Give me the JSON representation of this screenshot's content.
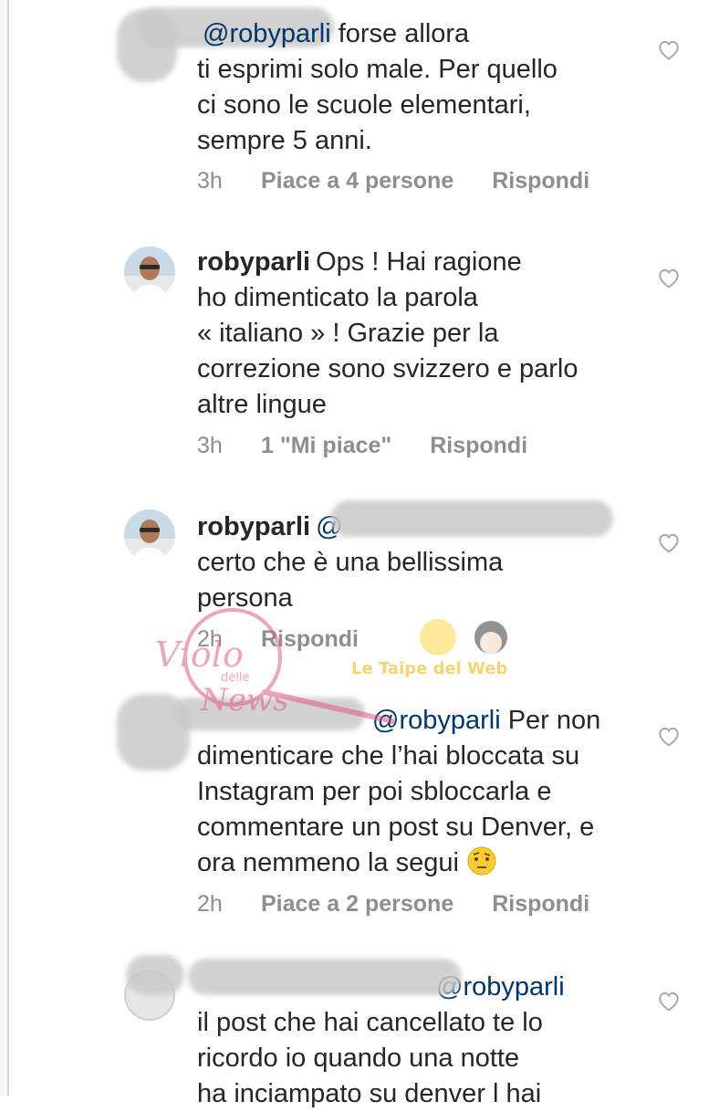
{
  "comments": [
    {
      "username": "",
      "mention": "@robyparli",
      "text": " forse allora\nti esprimi solo male. Per quello\nci sono le scuole elementari,\nsempre 5 anni.",
      "time": "3h",
      "likes": "Piace a 4 persone",
      "reply": "Rispondi"
    },
    {
      "username": "robyparli",
      "mention": "",
      "text": "Ops ! Hai ragione\nho dimenticato la parola\n« italiano » ! Grazie per la\ncorrezione sono svizzero e parlo\naltre lingue",
      "time": "3h",
      "likes": "1 \"Mi piace\"",
      "reply": "Rispondi"
    },
    {
      "username": "robyparli",
      "mention": "@",
      "text": "\ncerto che è una bellissima\npersona",
      "time": "2h",
      "likes": "",
      "reply": "Rispondi"
    },
    {
      "username": "",
      "mention": "@robyparli",
      "text": " Per non\ndimenticare che l’hai bloccata su\nInstagram per poi sbloccarla e\ncommentare un post su Denver, e\nora nemmeno la segui ",
      "time": "2h",
      "likes": "Piace a 2 persone",
      "reply": "Rispondi"
    },
    {
      "username": "",
      "mention": "@robyparli",
      "text": "\nil post che hai cancellato te lo\nricordo io quando una notte\nha inciampato su denver l hai",
      "time": "",
      "likes": "",
      "reply": ""
    }
  ],
  "watermark": {
    "line1": "Violo",
    "line2": "delle",
    "line3": "News",
    "tagline": "Le Taipe del Web"
  },
  "colors": {
    "text": "#262626",
    "meta": "#8e8e8e",
    "mention": "#003569",
    "watermark": "#e05a8a"
  }
}
